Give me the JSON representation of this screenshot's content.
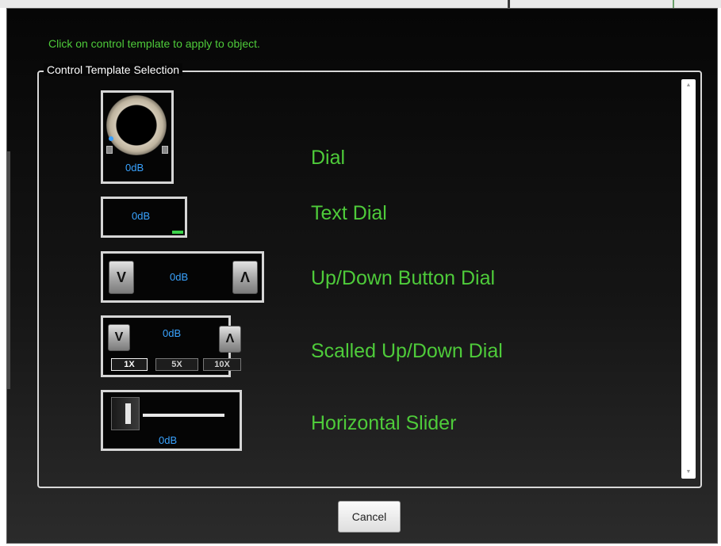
{
  "instruction": "Click on control template to apply to object.",
  "group_title": "Control Template Selection",
  "templates": [
    {
      "label": "Dial",
      "value": "0dB"
    },
    {
      "label": "Text Dial",
      "value": "0dB"
    },
    {
      "label": "Up/Down Button Dial",
      "value": "0dB",
      "down_symbol": "V",
      "up_symbol": "Λ"
    },
    {
      "label": "Scalled Up/Down Dial",
      "value": "0dB",
      "down_symbol": "V",
      "up_symbol": "Λ",
      "scales": [
        "1X",
        "5X",
        "10X"
      ],
      "active_scale": "1X"
    },
    {
      "label": "Horizontal Slider",
      "value": "0dB",
      "level": 0
    }
  ],
  "cancel_label": "Cancel",
  "colors": {
    "accent_green": "#4ecb3a",
    "value_blue": "#39a3ff"
  },
  "icons": {
    "scroll_up": "scroll-up-icon",
    "scroll_down": "scroll-down-icon"
  }
}
